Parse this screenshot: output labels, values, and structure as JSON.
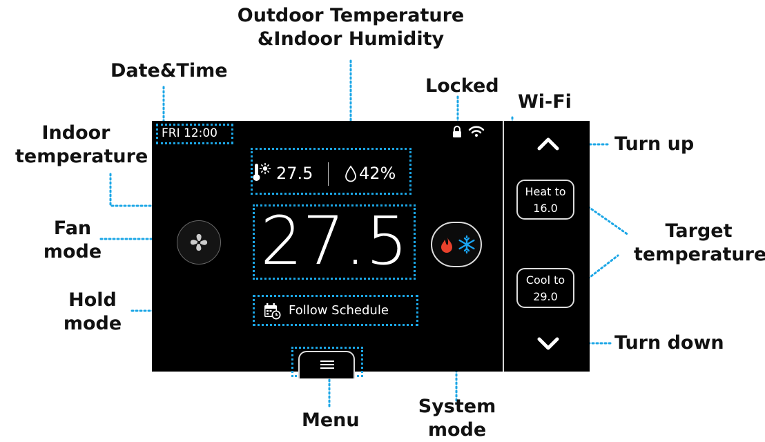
{
  "callouts": {
    "outdoor": [
      "Outdoor Temperature",
      "&Indoor Humidity"
    ],
    "datetime": "Date&Time",
    "locked": "Locked",
    "wifi": "Wi-Fi",
    "indoor_temp": [
      "Indoor",
      "temperature"
    ],
    "turn_up": "Turn up",
    "fan": [
      "Fan",
      "mode"
    ],
    "target": [
      "Target",
      "temperature"
    ],
    "hold": [
      "Hold",
      "mode"
    ],
    "turn_down": "Turn down",
    "menu": "Menu",
    "system": [
      "System",
      "mode"
    ]
  },
  "screen": {
    "datetime": "FRI 12:00",
    "outdoor_temp": "27.5",
    "indoor_humidity": "42%",
    "indoor_temp": "27.5",
    "hold_mode": "Follow Schedule",
    "heat_to": [
      "Heat to",
      "16.0"
    ],
    "cool_to": [
      "Cool to",
      "29.0"
    ]
  },
  "icons": [
    "lock-icon",
    "wifi-icon",
    "thermometer-sun-icon",
    "droplet-icon",
    "fan-icon",
    "flame-icon",
    "snowflake-icon",
    "calendar-clock-icon",
    "menu-icon",
    "chevron-up-icon",
    "chevron-down-icon"
  ],
  "colors": {
    "screen_bg": "#000000",
    "callout_dots": "#1ba6e6",
    "flame": "#e8412c",
    "snowflake": "#1aa3f0"
  }
}
